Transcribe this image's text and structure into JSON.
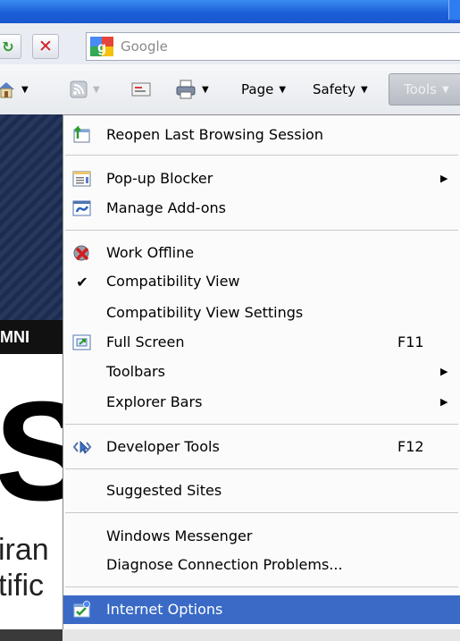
{
  "search": {
    "placeholder": "Google"
  },
  "command_bar": {
    "page_label": "Page",
    "safety_label": "Safety",
    "tools_label": "Tools"
  },
  "background": {
    "banner_text": "MNI",
    "big_letter": "S",
    "line1": "iran",
    "line2": "tific"
  },
  "menu": {
    "items": [
      {
        "label": "Reopen Last Browsing Session",
        "icon": "reopen-session-icon"
      },
      {
        "label": "Pop-up Blocker",
        "icon": "popup-blocker-icon",
        "submenu": true
      },
      {
        "label": "Manage Add-ons",
        "icon": "manage-addons-icon"
      },
      {
        "label": "Work Offline",
        "icon": "work-offline-icon"
      },
      {
        "label": "Compatibility View",
        "icon": "checkmark-icon",
        "checked": true
      },
      {
        "label": "Compatibility View Settings"
      },
      {
        "label": "Full Screen",
        "icon": "full-screen-icon",
        "shortcut": "F11"
      },
      {
        "label": "Toolbars",
        "submenu": true
      },
      {
        "label": "Explorer Bars",
        "submenu": true
      },
      {
        "label": "Developer Tools",
        "icon": "developer-tools-icon",
        "shortcut": "F12"
      },
      {
        "label": "Suggested Sites"
      },
      {
        "label": "Windows Messenger"
      },
      {
        "label": "Diagnose Connection Problems..."
      },
      {
        "label": "Internet Options",
        "icon": "internet-options-icon",
        "selected": true
      }
    ]
  },
  "colors": {
    "title_bar": "#1b5fd8",
    "menu_highlight": "#3a6ac6",
    "tools_button": "#c3c7cd"
  }
}
